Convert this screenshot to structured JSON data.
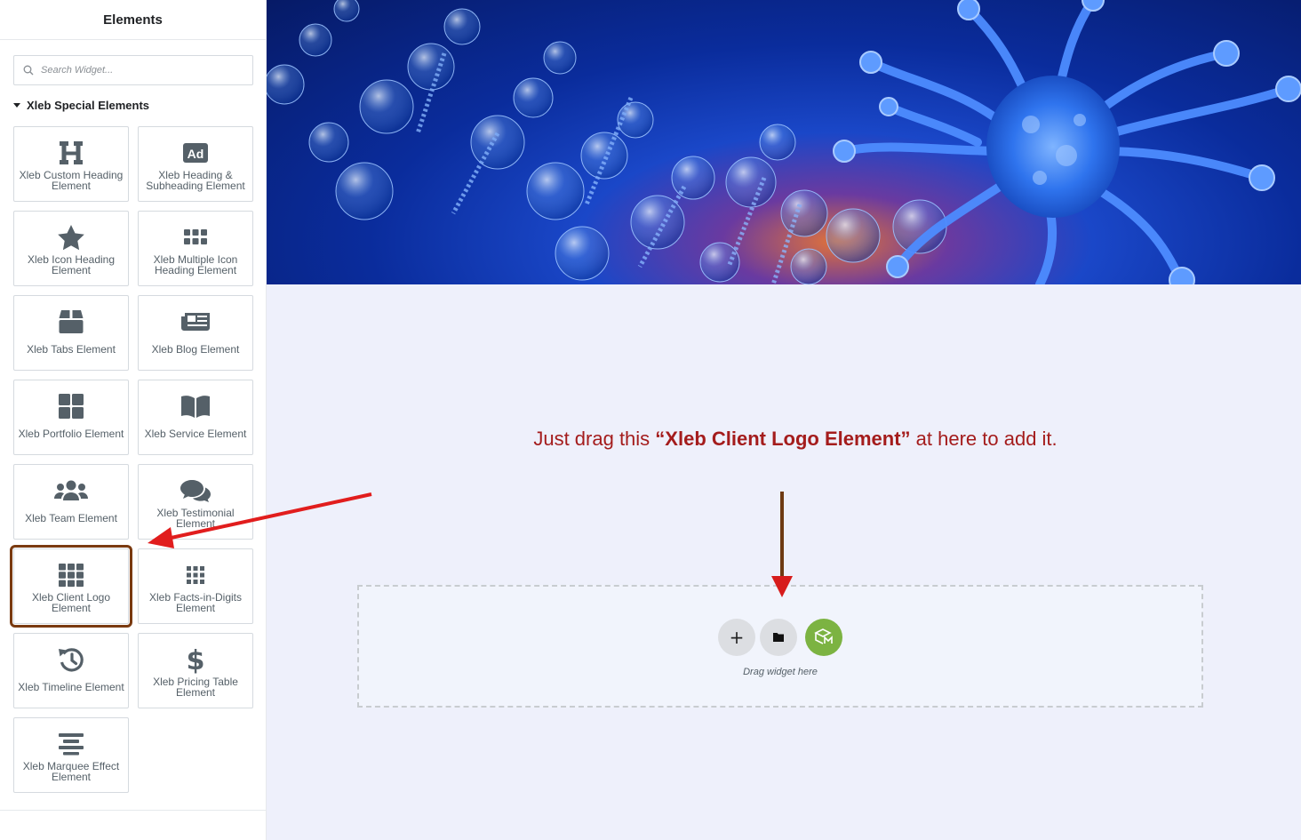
{
  "panel": {
    "title": "Elements",
    "search_placeholder": "Search Widget...",
    "category": "Xleb Special Elements"
  },
  "widgets": [
    {
      "icon": "heading-icon",
      "label": "Xleb Custom Heading Element"
    },
    {
      "icon": "ad-icon",
      "label": "Xleb Heading & Subheading Element"
    },
    {
      "icon": "star-icon",
      "label": "Xleb Icon Heading Element"
    },
    {
      "icon": "th-icon",
      "label": "Xleb Multiple Icon Heading Element"
    },
    {
      "icon": "box-icon",
      "label": "Xleb Tabs Element"
    },
    {
      "icon": "newspaper-icon",
      "label": "Xleb Blog Element"
    },
    {
      "icon": "grid-icon",
      "label": "Xleb Portfolio Element"
    },
    {
      "icon": "book-open-icon",
      "label": "Xleb Service Element"
    },
    {
      "icon": "users-icon",
      "label": "Xleb Team Element"
    },
    {
      "icon": "comments-icon",
      "label": "Xleb Testimonial Element"
    },
    {
      "icon": "th-large-icon",
      "label": "Xleb Client Logo Element"
    },
    {
      "icon": "dots-grid-icon",
      "label": "Xleb Facts-in-Digits Element"
    },
    {
      "icon": "history-icon",
      "label": "Xleb Timeline Element"
    },
    {
      "icon": "dollar-icon",
      "label": "Xleb Pricing Table Element"
    },
    {
      "icon": "align-center-icon",
      "label": "Xleb Marquee Effect Element"
    }
  ],
  "canvas": {
    "instruction_prefix": "Just drag this ",
    "instruction_bold": "“Xleb Client Logo Element”",
    "instruction_suffix": " at here to add it.",
    "drop_hint": "Drag widget here",
    "add_symbol": "+"
  },
  "colors": {
    "annotation_red": "#e11d1d",
    "annotation_brown": "#6e3a12",
    "highlight_border": "#7a3a10",
    "brand_green": "#7cb342"
  }
}
